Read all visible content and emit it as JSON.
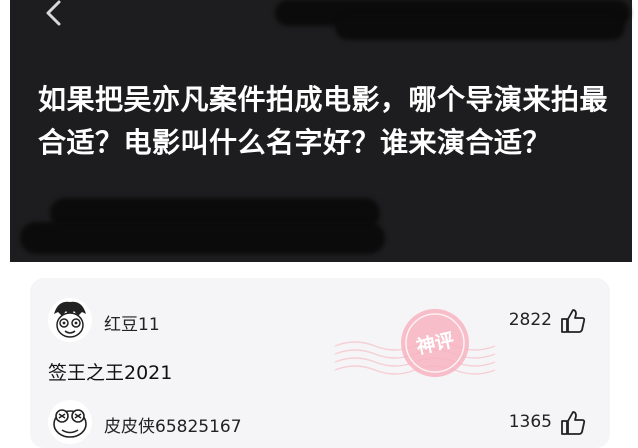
{
  "header": {
    "back_icon": "chevron-left-icon",
    "question_title": "如果把吴亦凡案件拍成电影，哪个导演来拍最合适？电影叫什么名字好？谁来演合适？"
  },
  "comments": [
    {
      "username": "红豆11",
      "like_count": "2822",
      "text": "签王之王2021",
      "avatar_icon": "cartoon-face-avatar-icon",
      "like_icon": "thumbs-up-icon"
    },
    {
      "username": "皮皮侠65825167",
      "like_count": "1365",
      "text": "",
      "avatar_icon": "frog-face-avatar-icon",
      "like_icon": "thumbs-up-icon"
    }
  ],
  "badge": {
    "text": "神评",
    "stamp_icon": "postmark-stamp-icon",
    "color": "#f08c9c"
  },
  "colors": {
    "header_bg": "#1d1d1f",
    "card_bg": "#f5f5f7"
  }
}
